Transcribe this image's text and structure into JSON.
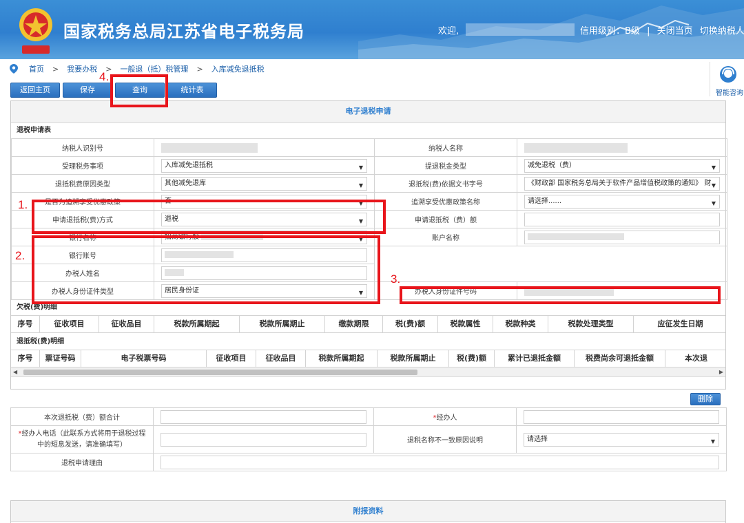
{
  "header": {
    "title": "国家税务总局江苏省电子税务局",
    "welcome": "欢迎,",
    "credit_level": "信用级别：B级",
    "close_page": "关闭当页",
    "switch_taxpayer": "切换纳税人",
    "divider": "|"
  },
  "breadcrumb": {
    "items": [
      "首页",
      "我要办税",
      "一般退（抵）税管理",
      "入库减免退抵税"
    ],
    "separator": ">"
  },
  "toolbar": {
    "back": "返回主页",
    "save": "保存",
    "query": "查询",
    "stats": "统计表"
  },
  "help": {
    "label": "智能咨询"
  },
  "form": {
    "panel_title": "电子退税申请",
    "section": "退税申请表",
    "taxpayer_id_label": "纳税人识别号",
    "taxpayer_name_label": "纳税人名称",
    "tax_item_label": "受理税务事项",
    "tax_item_value": "入库减免退抵税",
    "refund_type_label": "提退税金类型",
    "refund_type_value": "减免退税（费）",
    "reason_type_label": "退抵税费原因类型",
    "reason_type_value": "其他减免退库",
    "doc_no_label": "退抵税(费)依据文书字号",
    "doc_no_value": "《财政部 国家税务总局关于软件产品增值税政策的通知》 财",
    "retro_label": "是否为追溯享受优惠政策",
    "retro_value": "否",
    "retro_policy_label": "追溯享受优惠政策名称",
    "retro_policy_value": "请选择......",
    "method_label": "申请退抵税(费)方式",
    "method_value": "退税",
    "amount_label": "申请退抵税（费）额",
    "bank_name_label": "银行名称",
    "bank_name_value": "招商银行股",
    "account_name_label": "账户名称",
    "bank_account_label": "银行账号",
    "handler_name_label": "办税人姓名",
    "id_type_label": "办税人身份证件类型",
    "id_type_value": "居民身份证",
    "id_no_label": "办税人身份证件号码"
  },
  "owed": {
    "title": "欠税(费)明细",
    "columns": [
      "序号",
      "征收项目",
      "征收品目",
      "税款所属期起",
      "税款所属期止",
      "缴款期限",
      "税(费)额",
      "税款属性",
      "税款种类",
      "税款处理类型",
      "应征发生日期"
    ]
  },
  "refund": {
    "title": "退抵税(费)明细",
    "columns": [
      "序号",
      "票证号码",
      "电子税票号码",
      "征收项目",
      "征收品目",
      "税款所属期起",
      "税款所属期止",
      "税(费)额",
      "累计已退抵金额",
      "税费尚余可退抵金额",
      "本次退"
    ]
  },
  "delete_button": "删除",
  "summary": {
    "total_label": "本次退抵税（费）额合计",
    "handler_label": "经办人",
    "phone_label_star": "*",
    "phone_label": "经办人电话（此联系方式将用于退税过程中的短息发送，请准确填写）",
    "handler_star": "*",
    "mismatch_label": "退税名称不一致原因说明",
    "mismatch_value": "请选择",
    "reason_label": "退税申请理由"
  },
  "attachments": {
    "title": "附报资料"
  },
  "annotations": [
    "1.",
    "2.",
    "3.",
    "4."
  ],
  "colors": {
    "header_blue": "#2f7fcf",
    "button_blue": "#2a6fbe",
    "annotation_red": "#e8151b"
  }
}
